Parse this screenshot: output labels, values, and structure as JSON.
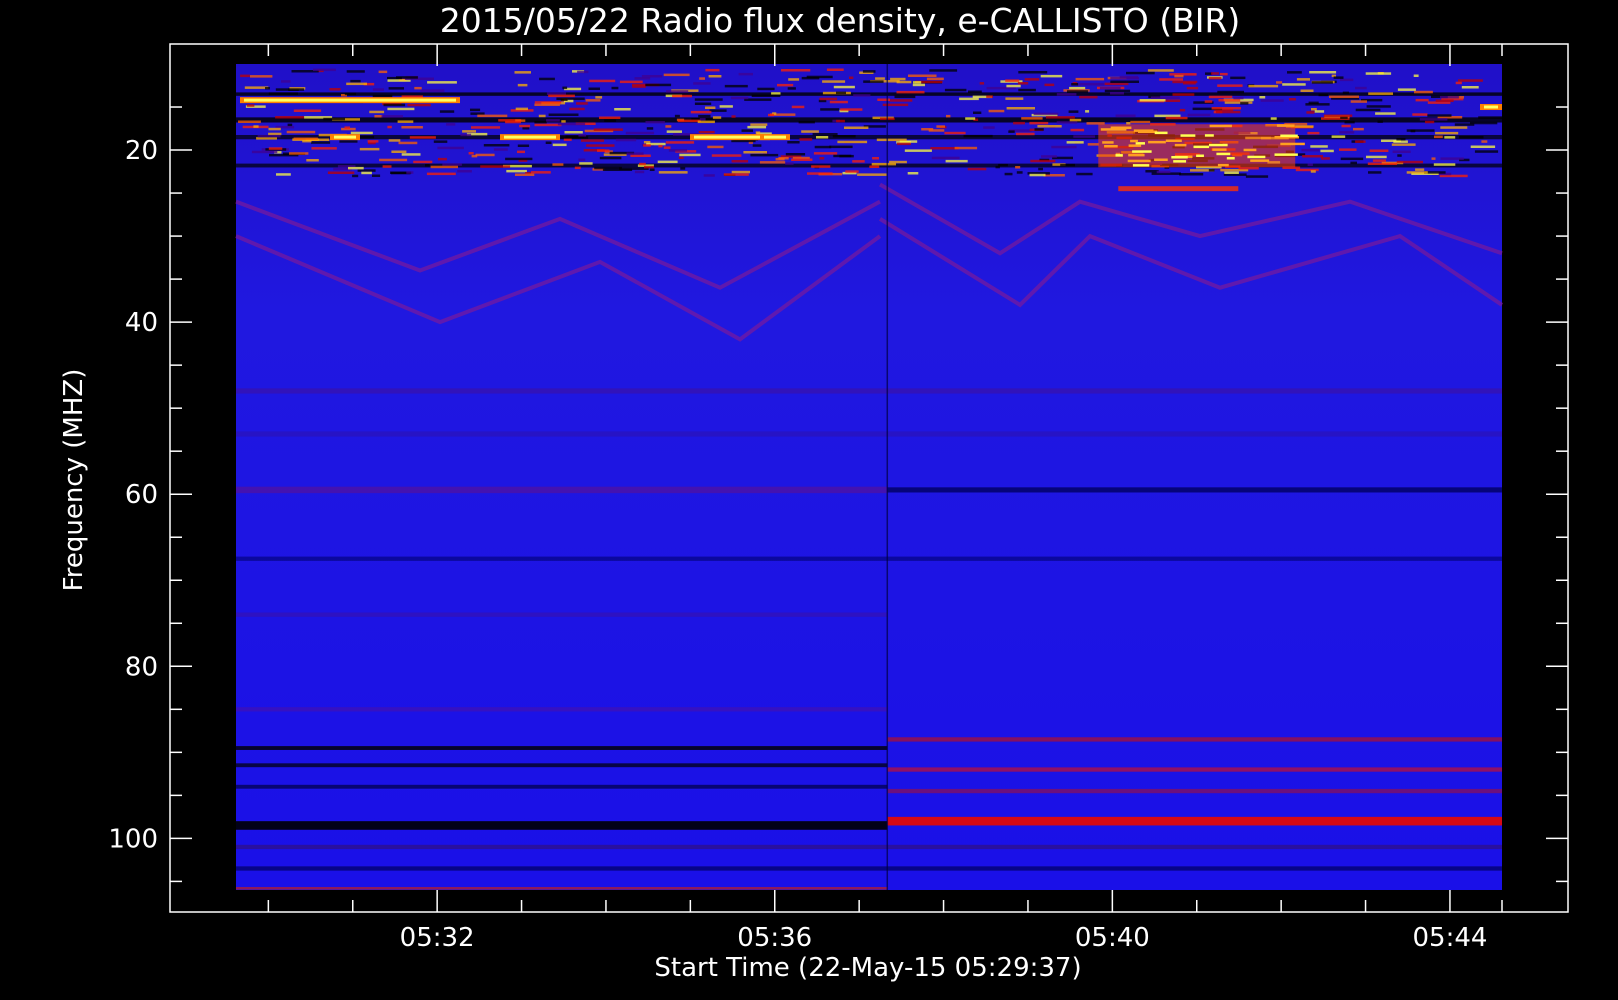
{
  "chart_data": {
    "type": "heatmap",
    "title": "2015/05/22  Radio flux density, e-CALLISTO (BIR)",
    "xlabel": "Start Time (22-May-15 05:29:37)",
    "ylabel": "Frequency (MHZ)",
    "x_unit": "UT time",
    "x_range": [
      "05:29:37",
      "05:44:37"
    ],
    "x_ticks": [
      {
        "t": "05:32",
        "label": "05:32"
      },
      {
        "t": "05:36",
        "label": "05:36"
      },
      {
        "t": "05:40",
        "label": "05:40"
      },
      {
        "t": "05:44",
        "label": "05:44"
      }
    ],
    "ylim": [
      107,
      10
    ],
    "y_inverted": true,
    "y_ticks": [
      20,
      40,
      60,
      80,
      100
    ],
    "y_minor_ticks": [
      15,
      25,
      30,
      35,
      45,
      50,
      55,
      65,
      70,
      75,
      85,
      90,
      95,
      105
    ],
    "colormap": [
      "#000000",
      "#0000ff",
      "#ff0000",
      "#ffff00",
      "#ffffff"
    ],
    "grid": false,
    "legend": "none",
    "observation_gap_at": "05:37:20",
    "features": [
      {
        "description": "bright interference band",
        "freq_range_mhz": [
          10,
          23
        ]
      },
      {
        "description": "emission patch",
        "time_range": [
          "05:39:50",
          "05:42:10"
        ],
        "freq_range_mhz": [
          17,
          22
        ]
      },
      {
        "description": "strong emission band",
        "time_range": [
          "05:37:20",
          "05:44:37"
        ],
        "freq_range_mhz": [
          97,
          99
        ]
      }
    ]
  }
}
